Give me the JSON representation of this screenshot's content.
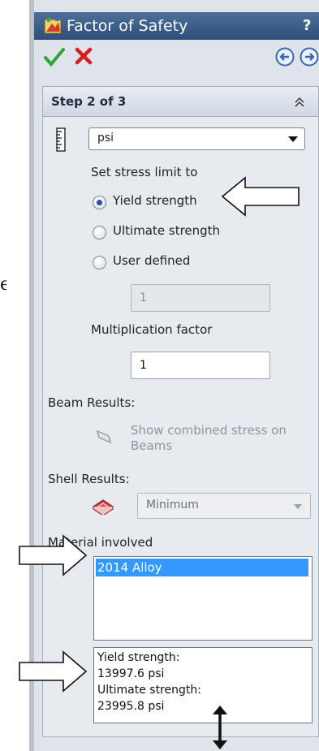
{
  "fragment": "e",
  "title": "Factor of Safety",
  "help_label": "?",
  "step": {
    "title": "Step 2 of 3"
  },
  "units": {
    "value": "psi"
  },
  "stress_limit": {
    "label": "Set stress limit to",
    "options": [
      "Yield strength",
      "Ultimate strength",
      "User defined"
    ],
    "selected": "Yield strength",
    "user_defined_value": "1"
  },
  "multiplication": {
    "label": "Multiplication factor",
    "value": "1"
  },
  "beam": {
    "label": "Beam Results:",
    "show_label": "Show combined stress on Beams"
  },
  "shell": {
    "label": "Shell Results:",
    "value": "Minimum"
  },
  "material": {
    "label": "Material involved",
    "items": [
      "2014 Alloy"
    ],
    "info": [
      "Yield strength:",
      "13997.6 psi",
      "Ultimate strength:",
      "23995.8 psi"
    ]
  },
  "colors": {
    "title_bar": "#3b5b87",
    "selection": "#3399ff",
    "panel": "#dfe4ea"
  },
  "icons": [
    "model-icon",
    "check-icon",
    "close-icon",
    "back-icon",
    "next-icon",
    "collapse-icon",
    "ruler-icon",
    "beam-icon",
    "shell-icon"
  ]
}
